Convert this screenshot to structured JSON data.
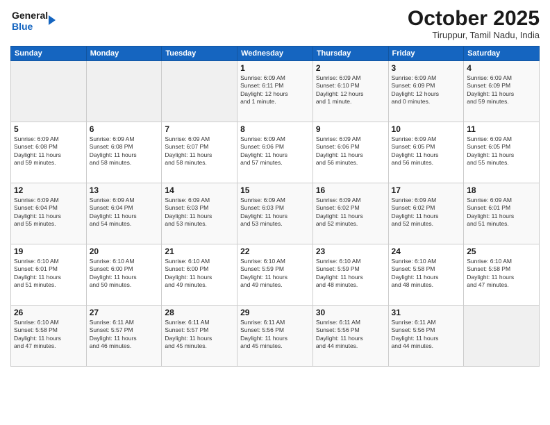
{
  "logo": {
    "line1": "General",
    "line2": "Blue"
  },
  "header": {
    "month": "October 2025",
    "location": "Tiruppur, Tamil Nadu, India"
  },
  "weekdays": [
    "Sunday",
    "Monday",
    "Tuesday",
    "Wednesday",
    "Thursday",
    "Friday",
    "Saturday"
  ],
  "weeks": [
    [
      {
        "day": "",
        "info": ""
      },
      {
        "day": "",
        "info": ""
      },
      {
        "day": "",
        "info": ""
      },
      {
        "day": "1",
        "info": "Sunrise: 6:09 AM\nSunset: 6:11 PM\nDaylight: 12 hours\nand 1 minute."
      },
      {
        "day": "2",
        "info": "Sunrise: 6:09 AM\nSunset: 6:10 PM\nDaylight: 12 hours\nand 1 minute."
      },
      {
        "day": "3",
        "info": "Sunrise: 6:09 AM\nSunset: 6:09 PM\nDaylight: 12 hours\nand 0 minutes."
      },
      {
        "day": "4",
        "info": "Sunrise: 6:09 AM\nSunset: 6:09 PM\nDaylight: 11 hours\nand 59 minutes."
      }
    ],
    [
      {
        "day": "5",
        "info": "Sunrise: 6:09 AM\nSunset: 6:08 PM\nDaylight: 11 hours\nand 59 minutes."
      },
      {
        "day": "6",
        "info": "Sunrise: 6:09 AM\nSunset: 6:08 PM\nDaylight: 11 hours\nand 58 minutes."
      },
      {
        "day": "7",
        "info": "Sunrise: 6:09 AM\nSunset: 6:07 PM\nDaylight: 11 hours\nand 58 minutes."
      },
      {
        "day": "8",
        "info": "Sunrise: 6:09 AM\nSunset: 6:06 PM\nDaylight: 11 hours\nand 57 minutes."
      },
      {
        "day": "9",
        "info": "Sunrise: 6:09 AM\nSunset: 6:06 PM\nDaylight: 11 hours\nand 56 minutes."
      },
      {
        "day": "10",
        "info": "Sunrise: 6:09 AM\nSunset: 6:05 PM\nDaylight: 11 hours\nand 56 minutes."
      },
      {
        "day": "11",
        "info": "Sunrise: 6:09 AM\nSunset: 6:05 PM\nDaylight: 11 hours\nand 55 minutes."
      }
    ],
    [
      {
        "day": "12",
        "info": "Sunrise: 6:09 AM\nSunset: 6:04 PM\nDaylight: 11 hours\nand 55 minutes."
      },
      {
        "day": "13",
        "info": "Sunrise: 6:09 AM\nSunset: 6:04 PM\nDaylight: 11 hours\nand 54 minutes."
      },
      {
        "day": "14",
        "info": "Sunrise: 6:09 AM\nSunset: 6:03 PM\nDaylight: 11 hours\nand 53 minutes."
      },
      {
        "day": "15",
        "info": "Sunrise: 6:09 AM\nSunset: 6:03 PM\nDaylight: 11 hours\nand 53 minutes."
      },
      {
        "day": "16",
        "info": "Sunrise: 6:09 AM\nSunset: 6:02 PM\nDaylight: 11 hours\nand 52 minutes."
      },
      {
        "day": "17",
        "info": "Sunrise: 6:09 AM\nSunset: 6:02 PM\nDaylight: 11 hours\nand 52 minutes."
      },
      {
        "day": "18",
        "info": "Sunrise: 6:09 AM\nSunset: 6:01 PM\nDaylight: 11 hours\nand 51 minutes."
      }
    ],
    [
      {
        "day": "19",
        "info": "Sunrise: 6:10 AM\nSunset: 6:01 PM\nDaylight: 11 hours\nand 51 minutes."
      },
      {
        "day": "20",
        "info": "Sunrise: 6:10 AM\nSunset: 6:00 PM\nDaylight: 11 hours\nand 50 minutes."
      },
      {
        "day": "21",
        "info": "Sunrise: 6:10 AM\nSunset: 6:00 PM\nDaylight: 11 hours\nand 49 minutes."
      },
      {
        "day": "22",
        "info": "Sunrise: 6:10 AM\nSunset: 5:59 PM\nDaylight: 11 hours\nand 49 minutes."
      },
      {
        "day": "23",
        "info": "Sunrise: 6:10 AM\nSunset: 5:59 PM\nDaylight: 11 hours\nand 48 minutes."
      },
      {
        "day": "24",
        "info": "Sunrise: 6:10 AM\nSunset: 5:58 PM\nDaylight: 11 hours\nand 48 minutes."
      },
      {
        "day": "25",
        "info": "Sunrise: 6:10 AM\nSunset: 5:58 PM\nDaylight: 11 hours\nand 47 minutes."
      }
    ],
    [
      {
        "day": "26",
        "info": "Sunrise: 6:10 AM\nSunset: 5:58 PM\nDaylight: 11 hours\nand 47 minutes."
      },
      {
        "day": "27",
        "info": "Sunrise: 6:11 AM\nSunset: 5:57 PM\nDaylight: 11 hours\nand 46 minutes."
      },
      {
        "day": "28",
        "info": "Sunrise: 6:11 AM\nSunset: 5:57 PM\nDaylight: 11 hours\nand 45 minutes."
      },
      {
        "day": "29",
        "info": "Sunrise: 6:11 AM\nSunset: 5:56 PM\nDaylight: 11 hours\nand 45 minutes."
      },
      {
        "day": "30",
        "info": "Sunrise: 6:11 AM\nSunset: 5:56 PM\nDaylight: 11 hours\nand 44 minutes."
      },
      {
        "day": "31",
        "info": "Sunrise: 6:11 AM\nSunset: 5:56 PM\nDaylight: 11 hours\nand 44 minutes."
      },
      {
        "day": "",
        "info": ""
      }
    ]
  ]
}
